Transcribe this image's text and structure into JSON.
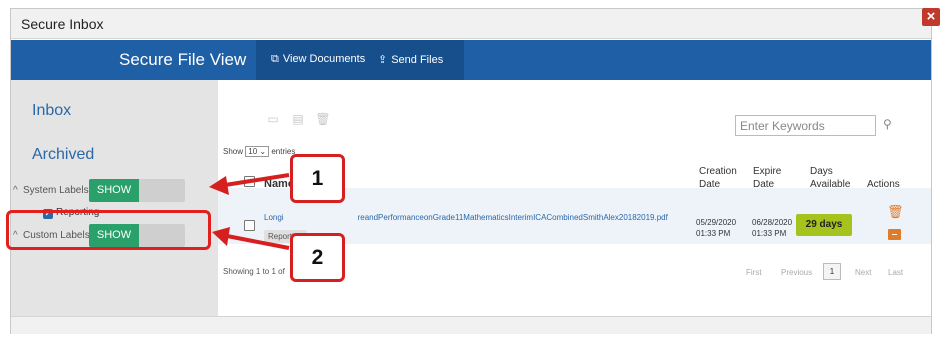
{
  "window": {
    "title": "Secure Inbox",
    "close_label": "×"
  },
  "navbar": {
    "brand": "Secure File View",
    "view_documents": "View Documents",
    "send_files": "Send Files"
  },
  "sidebar": {
    "inbox": "Inbox",
    "archived": "Archived",
    "system_labels": "System Labels",
    "custom_labels": "Custom Labels",
    "toggle_show": "SHOW",
    "reporting": "Reporting"
  },
  "toolbar": {
    "search_placeholder": "Enter Keywords"
  },
  "entries": {
    "show": "Show",
    "count": "10",
    "suffix": "entries"
  },
  "table": {
    "columns": {
      "name": "Name",
      "creation_date": "Creation Date",
      "expire_date": "Expire Date",
      "days_available": "Days Available",
      "actions": "Actions"
    },
    "rows": [
      {
        "file_name_left": "Longi",
        "file_name_right": "reandPerformanceonGrade11MathematicsInterimICACombinedSmithAlex20182019.pdf",
        "tag": "Reporting",
        "creation_date": "05/29/2020",
        "creation_time": "01:33 PM",
        "expire_date": "06/28/2020",
        "expire_time": "01:33 PM",
        "days_available": "29 days"
      }
    ]
  },
  "footer": {
    "showing": "Showing 1 to 1 of",
    "first": "First",
    "previous": "Previous",
    "current_page": "1",
    "next": "Next",
    "last": "Last"
  },
  "callouts": {
    "one": "1",
    "two": "2"
  },
  "colors": {
    "nav": "#1f5fa6",
    "toggle_on": "#2aa06a",
    "badge": "#a6c21c",
    "callout": "#d61f1f",
    "action_icon": "#e07b2a"
  }
}
